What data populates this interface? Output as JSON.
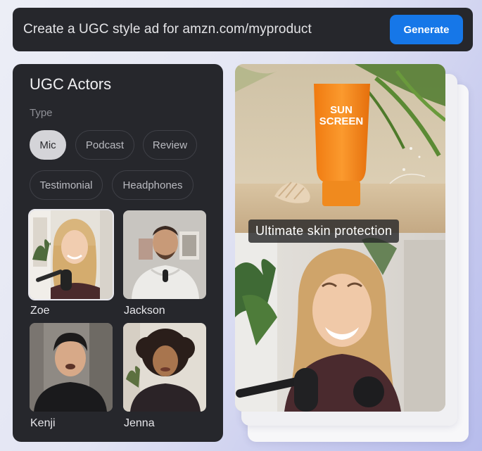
{
  "prompt": {
    "text": "Create a UGC style ad for amzn.com/myproduct",
    "generate_label": "Generate"
  },
  "actors_panel": {
    "title": "UGC Actors",
    "type_label": "Type",
    "types": [
      "Mic",
      "Podcast",
      "Review",
      "Testimonial",
      "Headphones"
    ],
    "active_type": "Mic",
    "actors": [
      {
        "name": "Zoe",
        "selected": true
      },
      {
        "name": "Jackson",
        "selected": false
      },
      {
        "name": "Kenji",
        "selected": false
      },
      {
        "name": "Jenna",
        "selected": false
      }
    ]
  },
  "preview": {
    "product_line1": "SUN",
    "product_line2": "SCREEN",
    "caption": "Ultimate skin protection"
  },
  "colors": {
    "accent": "#1677e8",
    "panel": "#26272c",
    "product": "#f6861c"
  }
}
